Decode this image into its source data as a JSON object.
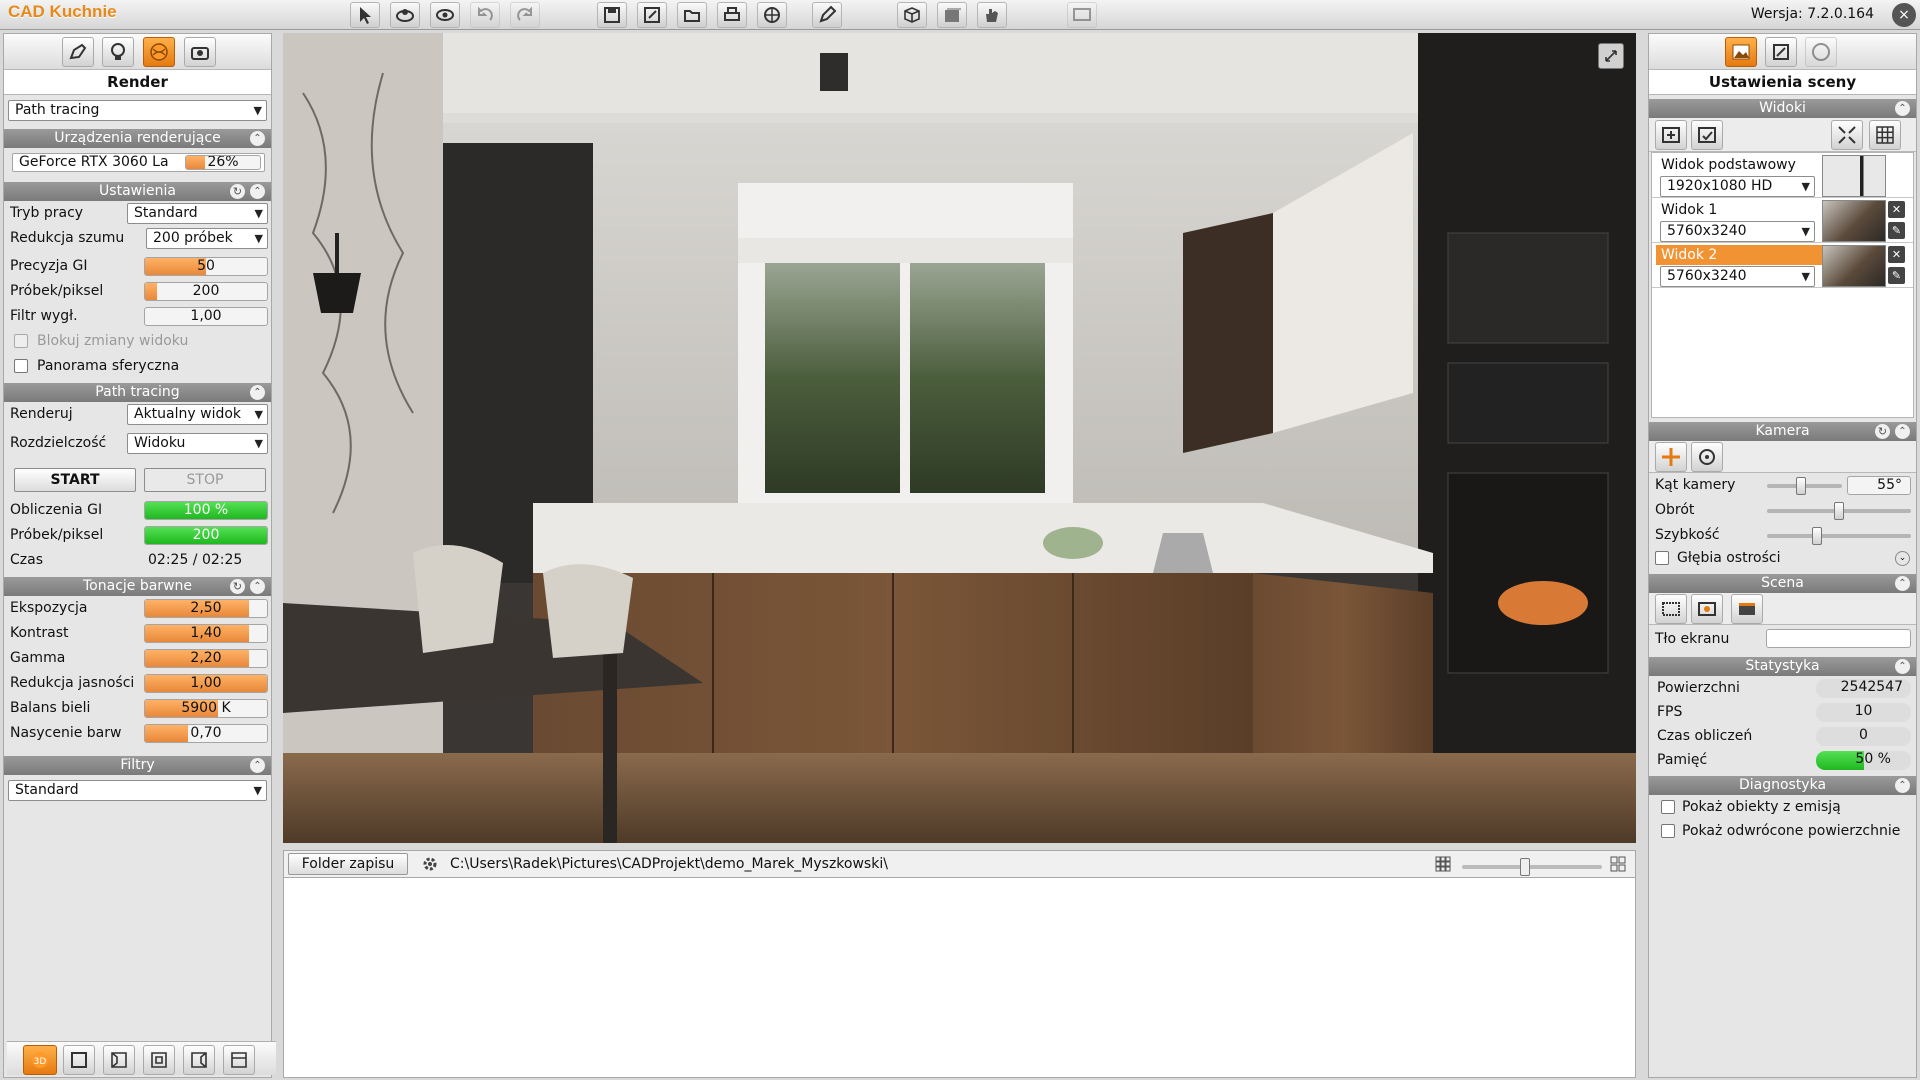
{
  "app": {
    "title": "CAD Kuchnie",
    "version": "Wersja: 7.2.0.164",
    "close": "×"
  },
  "toolbar_icons": [
    "cursor-icon",
    "orbit-icon",
    "eye-icon",
    "undo-icon",
    "redo-icon",
    "save-icon",
    "save-as-icon",
    "open-icon",
    "print-icon",
    "globe-icon",
    "pen-icon",
    "cube-icon",
    "box-icon",
    "hand-icon",
    "screen-icon"
  ],
  "left": {
    "title": "Render",
    "mode": "Path tracing",
    "devices": {
      "header": "Urządzenia renderujące",
      "gpu": "GeForce RTX 3060 La",
      "usage_text": "26%",
      "usage": 0.26
    },
    "settings": {
      "header": "Ustawienia",
      "work_mode_label": "Tryb pracy",
      "work_mode": "Standard",
      "noise_label": "Redukcja szumu",
      "noise": "200 próbek",
      "gi_label": "Precyzja GI",
      "gi_text": "50",
      "gi": 0.5,
      "spp_label": "Próbek/piksel",
      "spp_text": "200",
      "spp": 0.1,
      "filter_label": "Filtr wygł.",
      "filter_text": "1,00",
      "lock_label": "Blokuj zmiany widoku",
      "panorama_label": "Panorama sferyczna"
    },
    "pathtracing": {
      "header": "Path tracing",
      "render_label": "Renderuj",
      "render": "Aktualny widok",
      "res_label": "Rozdzielczość",
      "res": "Widoku",
      "start": "START",
      "stop": "STOP",
      "gi_calc_label": "Obliczenia GI",
      "gi_calc_text": "100 %",
      "gi_calc": 1.0,
      "spp_label": "Próbek/piksel",
      "spp_text": "200",
      "spp": 1.0,
      "time_label": "Czas",
      "time": "02:25 / 02:25"
    },
    "tones": {
      "header": "Tonacje barwne",
      "items": [
        {
          "label": "Ekspozycja",
          "text": "2,50",
          "fill": 0.85
        },
        {
          "label": "Kontrast",
          "text": "1,40",
          "fill": 0.85
        },
        {
          "label": "Gamma",
          "text": "2,20",
          "fill": 0.85
        },
        {
          "label": "Redukcja jasności",
          "text": "1,00",
          "fill": 1.0
        },
        {
          "label": "Balans bieli",
          "text": "5900 K",
          "fill": 0.6
        },
        {
          "label": "Nasycenie barw",
          "text": "0,70",
          "fill": 0.35
        }
      ]
    },
    "filters": {
      "header": "Filtry",
      "value": "Standard"
    }
  },
  "bottom": {
    "folder_label": "Folder zapisu",
    "path": "C:\\Users\\Radek\\Pictures\\CADProjekt\\demo_Marek_Myszkowski\\",
    "zoom": 0.45
  },
  "right": {
    "title": "Ustawienia sceny",
    "views": {
      "header": "Widoki",
      "items": [
        {
          "name": "Widok podstawowy",
          "res": "1920x1080 HD"
        },
        {
          "name": "Widok 1",
          "res": "5760x3240"
        },
        {
          "name": "Widok 2",
          "res": "5760x3240"
        }
      ]
    },
    "camera": {
      "header": "Kamera",
      "angle_label": "Kąt kamery",
      "angle": "55°",
      "angle_pos": 0.45,
      "rotation_label": "Obrót",
      "rotation_pos": 0.5,
      "speed_label": "Szybkość",
      "speed_pos": 0.35,
      "dof_label": "Głębia ostrości"
    },
    "scene": {
      "header": "Scena",
      "bg_label": "Tło ekranu"
    },
    "stats": {
      "header": "Statystyka",
      "surfaces_label": "Powierzchni",
      "surfaces": "2542547",
      "fps_label": "FPS",
      "fps": "10",
      "calc_label": "Czas obliczeń",
      "calc": "0",
      "mem_label": "Pamięć",
      "mem_text": "50 %",
      "mem": 0.5
    },
    "diag": {
      "header": "Diagnostyka",
      "emission_label": "Pokaż obiekty z emisją",
      "reversed_label": "Pokaż odwrócone powierzchnie"
    }
  },
  "colors": {
    "accent": "#f29333",
    "green": "#1fb81f",
    "header": "#8a8a8a"
  }
}
